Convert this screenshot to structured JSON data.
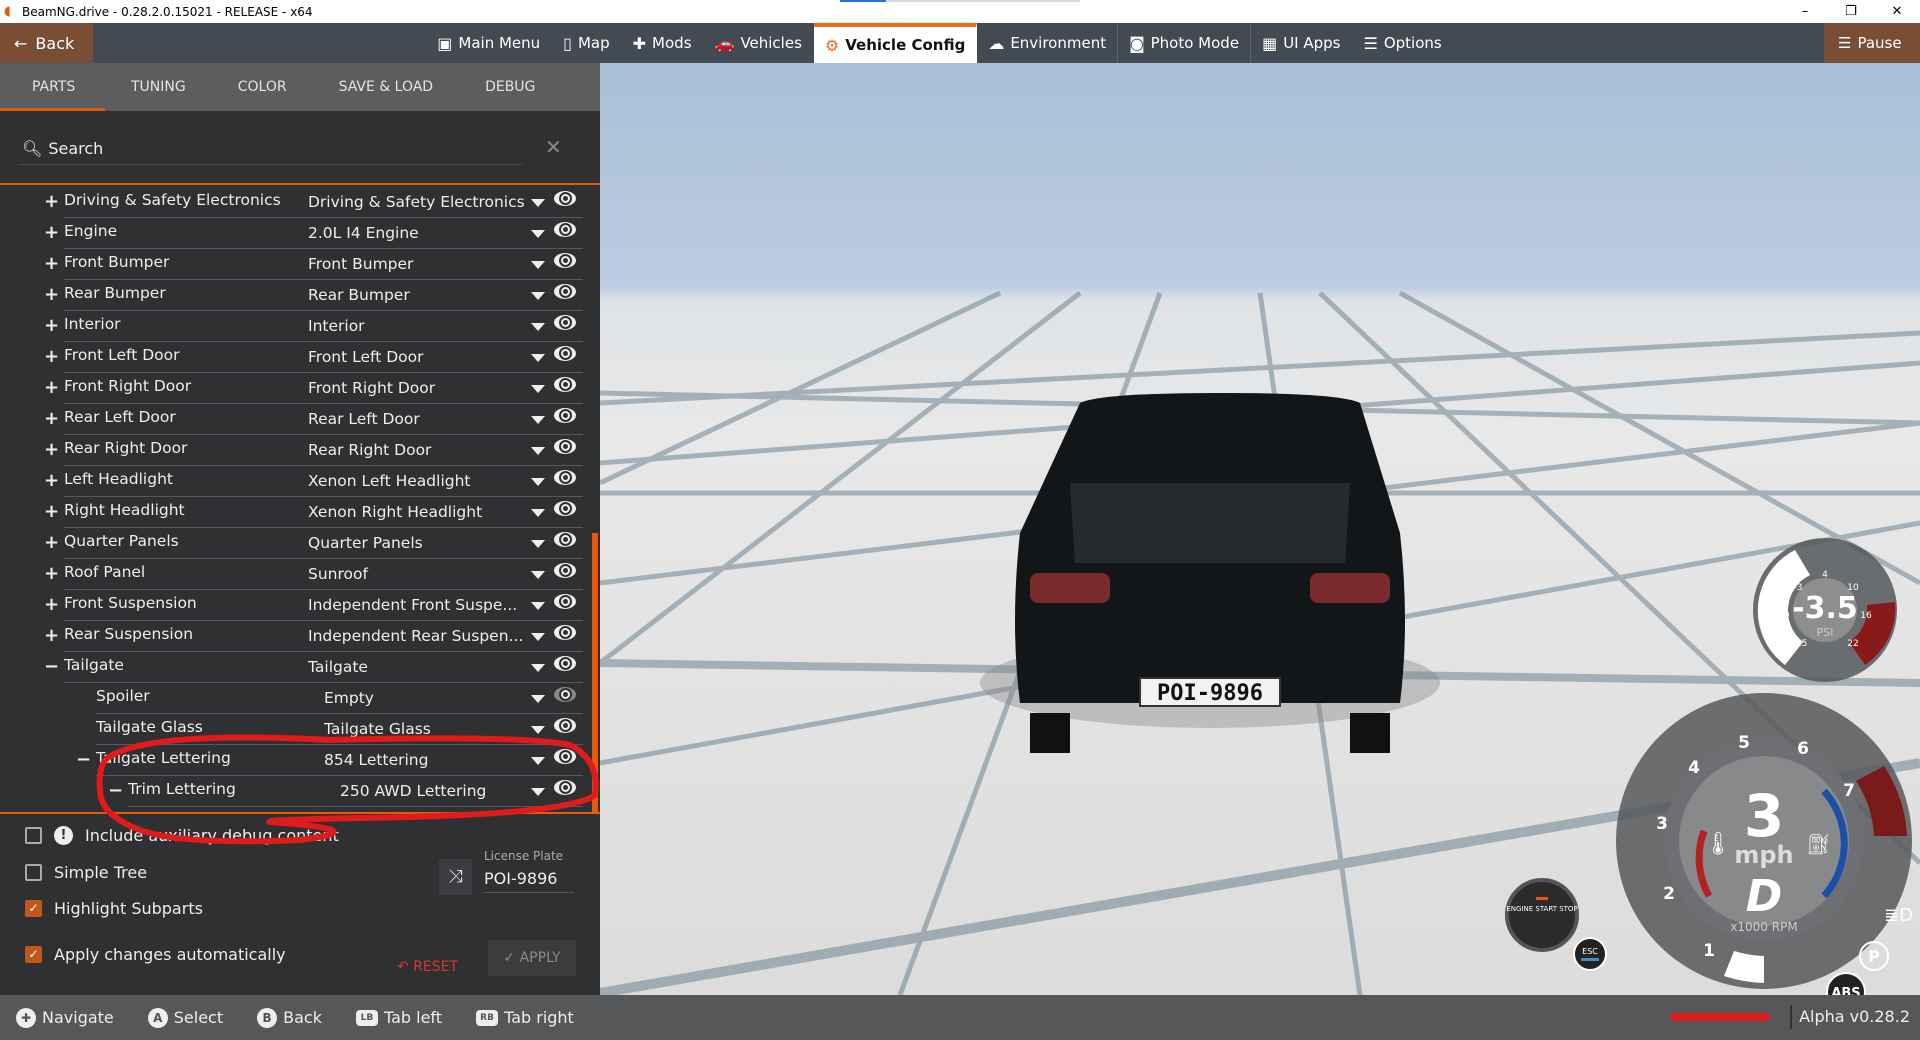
{
  "window": {
    "title": "BeamNG.drive - 0.28.2.0.15021 - RELEASE - x64",
    "minimize": "–",
    "maximize": "❐",
    "close": "✕"
  },
  "topnav": {
    "back": "Back",
    "pause": "Pause",
    "items": [
      {
        "label": "Main Menu",
        "icon": "▣"
      },
      {
        "label": "Map",
        "icon": "▯"
      },
      {
        "label": "Mods",
        "icon": "✚"
      },
      {
        "label": "Vehicles",
        "icon": "🚗"
      },
      {
        "label": "Vehicle Config",
        "icon": "⚙"
      },
      {
        "label": "Environment",
        "icon": "☁"
      },
      {
        "label": "Photo Mode",
        "icon": "◙"
      },
      {
        "label": "UI Apps",
        "icon": "▦"
      },
      {
        "label": "Options",
        "icon": "☰"
      }
    ]
  },
  "tabs": [
    "PARTS",
    "TUNING",
    "COLOR",
    "SAVE & LOAD",
    "DEBUG"
  ],
  "search": {
    "placeholder": "Search",
    "clear": "✕"
  },
  "parts": [
    {
      "name": "Driving & Safety Electronics",
      "value": "Driving & Safety Electronics",
      "exp": "+",
      "level": 0
    },
    {
      "name": "Engine",
      "value": "2.0L I4 Engine",
      "exp": "+",
      "level": 0
    },
    {
      "name": "Front Bumper",
      "value": "Front Bumper",
      "exp": "+",
      "level": 0
    },
    {
      "name": "Rear Bumper",
      "value": "Rear Bumper",
      "exp": "+",
      "level": 0
    },
    {
      "name": "Interior",
      "value": "Interior",
      "exp": "+",
      "level": 0
    },
    {
      "name": "Front Left Door",
      "value": "Front Left Door",
      "exp": "+",
      "level": 0
    },
    {
      "name": "Front Right Door",
      "value": "Front Right Door",
      "exp": "+",
      "level": 0
    },
    {
      "name": "Rear Left Door",
      "value": "Rear Left Door",
      "exp": "+",
      "level": 0
    },
    {
      "name": "Rear Right Door",
      "value": "Rear Right Door",
      "exp": "+",
      "level": 0
    },
    {
      "name": "Left Headlight",
      "value": "Xenon Left Headlight",
      "exp": "+",
      "level": 0
    },
    {
      "name": "Right Headlight",
      "value": "Xenon Right Headlight",
      "exp": "+",
      "level": 0
    },
    {
      "name": "Quarter Panels",
      "value": "Quarter Panels",
      "exp": "+",
      "level": 0
    },
    {
      "name": "Roof Panel",
      "value": "Sunroof",
      "exp": "+",
      "level": 0
    },
    {
      "name": "Front Suspension",
      "value": "Independent Front Suspe...",
      "exp": "+",
      "level": 0
    },
    {
      "name": "Rear Suspension",
      "value": "Independent Rear Suspen...",
      "exp": "+",
      "level": 0
    },
    {
      "name": "Tailgate",
      "value": "Tailgate",
      "exp": "−",
      "level": 0
    },
    {
      "name": "Spoiler",
      "value": "Empty",
      "exp": "",
      "level": 1,
      "dim": true
    },
    {
      "name": "Tailgate Glass",
      "value": "Tailgate Glass",
      "exp": "",
      "level": 1
    },
    {
      "name": "Tailgate Lettering",
      "value": "854 Lettering",
      "exp": "−",
      "level": 1
    },
    {
      "name": "Trim Lettering",
      "value": "250 AWD Lettering",
      "exp": "−",
      "level": 2
    }
  ],
  "options": {
    "debug": "Include auxiliary debug content",
    "simple_tree": "Simple Tree",
    "highlight": "Highlight Subparts",
    "auto_apply": "Apply changes automatically"
  },
  "license": {
    "label": "License Plate",
    "value": "POI-9896"
  },
  "actions": {
    "reset": "RESET",
    "apply": "APPLY"
  },
  "hints": [
    {
      "icon": "✚",
      "label": "Navigate"
    },
    {
      "icon": "A",
      "label": "Select"
    },
    {
      "icon": "B",
      "label": "Back"
    },
    {
      "icon": "LB",
      "label": "Tab left"
    },
    {
      "icon": "RB",
      "label": "Tab right"
    }
  ],
  "version": "Alpha v0.28.2",
  "car": {
    "plate": "POI-9896"
  },
  "boost": {
    "value": "-3.5",
    "unit": "PSI",
    "ticks": [
      "-15",
      "-9",
      "-3",
      "4",
      "10",
      "16",
      "22"
    ]
  },
  "speedo": {
    "speed": "3",
    "unit": "mph",
    "gear": "D",
    "rpm_label": "x1000 RPM",
    "ticks": [
      "1",
      "2",
      "3",
      "4",
      "5",
      "6",
      "7"
    ]
  },
  "engine_button": {
    "label": "ENGINE START STOP"
  },
  "esc": "ESC",
  "abs": "ABS",
  "park": "P"
}
